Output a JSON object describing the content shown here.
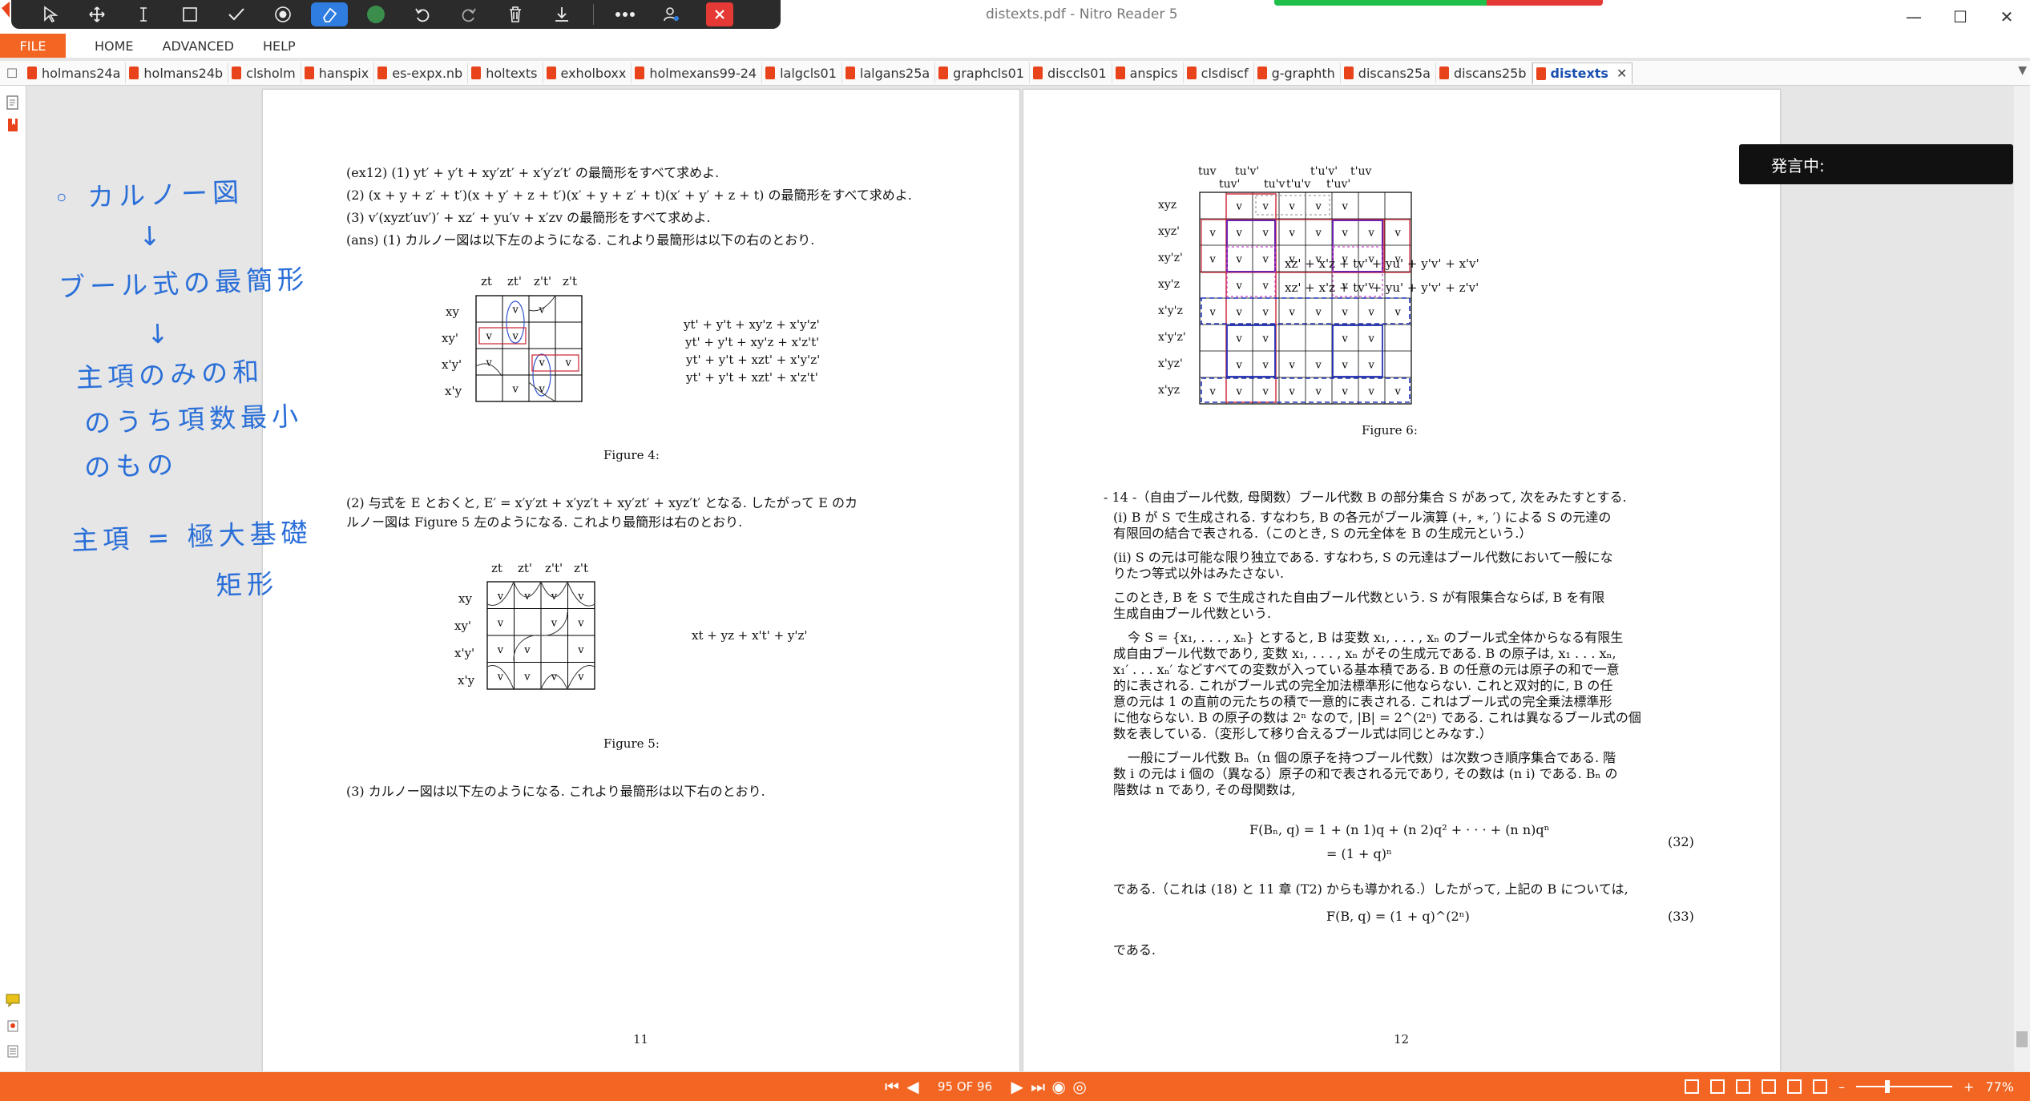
{
  "app": {
    "window_title": "distexts.pdf - Nitro Reader 5"
  },
  "window_buttons": [
    "—",
    "☐",
    "✕"
  ],
  "menu": {
    "file": "FILE",
    "items": [
      "HOME",
      "ADVANCED",
      "HELP"
    ]
  },
  "tabs": [
    "holmans24a",
    "holmans24b",
    "clsholm",
    "hanspix",
    "es-expx.nb",
    "holtexts",
    "exholboxx",
    "holmexans99-24",
    "lalgcls01",
    "lalgans25a",
    "graphcls01",
    "disccls01",
    "anspics",
    "clsdiscf",
    "g-graphth",
    "discans25a",
    "discans25b"
  ],
  "active_tab": "distexts",
  "active_tab_close": "✕",
  "page1": {
    "lines": [
      "(ex12) (1) yt′ + y′t + xy′zt′ + x′y′z′t′ の最簡形をすべて求めよ.",
      "(2) (x + y + z′ + t′)(x + y′ + z + t′)(x′ + y + z′ + t)(x′ + y′ + z + t) の最簡形をすべて求めよ.",
      "(3) v′(xyzt′uv′)′ + xz′ + yu′v + x′zv の最簡形をすべて求めよ.",
      "(ans) (1) カルノー図は以下左のようになる. これより最簡形は以下の右のとおり."
    ],
    "kmap4": {
      "cols": [
        "zt",
        "zt'",
        "z't'",
        "z't"
      ],
      "rows": [
        "xy",
        "xy'",
        "x'y'",
        "x'y"
      ],
      "cells": [
        [
          "",
          "v",
          "v",
          ""
        ],
        [
          "v",
          "v",
          "",
          ""
        ],
        [
          "v",
          "",
          "v",
          "v"
        ],
        [
          "",
          "v",
          "v",
          ""
        ]
      ],
      "results": [
        "yt' + y't + xy'z + x'y'z'",
        "yt' + y't + xy'z + x'z't'",
        "yt' + y't + xzt' + x'y'z'",
        "yt' + y't + xzt' + x'z't'"
      ],
      "caption": "Figure 4:"
    },
    "para2": [
      "(2) 与式を E とおくと, E′ = x′y′zt + x′yz′t + xy′zt′ + xyz′t′ となる. したがって E のカ",
      "ルノー図は Figure 5 左のようになる. これより最簡形は右のとおり."
    ],
    "kmap5": {
      "cols": [
        "zt",
        "zt'",
        "z't'",
        "z't"
      ],
      "rows": [
        "xy",
        "xy'",
        "x'y'",
        "x'y"
      ],
      "cells": [
        [
          "v",
          "v",
          "v",
          "v"
        ],
        [
          "v",
          "",
          "v",
          "v"
        ],
        [
          "v",
          "v",
          "",
          "v"
        ],
        [
          "v",
          "v",
          "v",
          "v"
        ]
      ],
      "result": "xt + yz + x't' + y'z'",
      "caption": "Figure 5:"
    },
    "para3": "(3) カルノー図は以下左のようになる. これより最簡形は以下右のとおり.",
    "page_number": "11"
  },
  "page2": {
    "kmap6": {
      "cols": [
        "tuv",
        "tuv'",
        "tu'v'",
        "tu'v",
        "t'u'v",
        "t'u'v'",
        "t'uv'",
        "t'uv"
      ],
      "rows": [
        "xyz",
        "xyz'",
        "xy'z'",
        "xy'z",
        "x'y'z",
        "x'y'z'",
        "x'yz'",
        "x'yz"
      ],
      "cells": [
        [
          "",
          "v",
          "v",
          "v",
          "v",
          "v",
          "",
          ""
        ],
        [
          "v",
          "v",
          "v",
          "v",
          "v",
          "v",
          "v",
          "v"
        ],
        [
          "v",
          "v",
          "v",
          "v",
          "v",
          "v",
          "v",
          "v"
        ],
        [
          "",
          "v",
          "v",
          "",
          "",
          "v",
          "v",
          ""
        ],
        [
          "v",
          "v",
          "v",
          "v",
          "v",
          "v",
          "v",
          "v"
        ],
        [
          "",
          "v",
          "v",
          "",
          "",
          "v",
          "v",
          ""
        ],
        [
          "",
          "v",
          "v",
          "v",
          "v",
          "v",
          "v",
          ""
        ],
        [
          "v",
          "v",
          "v",
          "v",
          "v",
          "v",
          "v",
          "v"
        ]
      ],
      "results": [
        "xz' + x'z + tv' + yu' + y'v' + x'v'",
        "xz' + x'z + tv' + yu' + y'v' + z'v'"
      ],
      "caption": "Figure 6:"
    },
    "paras": [
      "- 14 -（自由ブール代数, 母関数）ブール代数 B の部分集合 S があって, 次をみたすとする.",
      "(i) B が S で生成される. すなわち, B の各元がブール演算 (+, ∗, ′) による S の元達の",
      "有限回の結合で表される.（このとき, S の元全体を B の生成元という.）",
      "(ii) S の元は可能な限り独立である. すなわち, S の元達はブール代数において一般にな",
      "りたつ等式以外はみたさない.",
      "このとき, B を S で生成された自由ブール代数という. S が有限集合ならば, B を有限",
      "生成自由ブール代数という.",
      "今 S = {x₁, . . . , xₙ} とすると, B は変数 x₁, . . . , xₙ のブール式全体からなる有限生",
      "成自由ブール代数であり, 変数 x₁, . . . , xₙ がその生成元である. B の原子は, x₁ . . . xₙ,",
      "x₁′ . . . xₙ′ などすべての変数が入っている基本積である. B の任意の元は原子の和で一意",
      "的に表される. これがブール式の完全加法標準形に他ならない. これと双対的に, B の任",
      "意の元は 1 の直前の元たちの積で一意的に表される. これはブール式の完全乗法標準形",
      "に他ならない. B の原子の数は 2ⁿ なので, |B| = 2^(2ⁿ) である. これは異なるブール式の個",
      "数を表している.（変形して移り合えるブール式は同じとみなす.）",
      "一般にブール代数 Bₙ（n 個の原子を持つブール代数）は次数つき順序集合である. 階",
      "数 i の元は i 個の（異なる）原子の和で表される元であり, その数は (n i) である. Bₙ の",
      "階数は n であり, その母関数は,"
    ],
    "eq32_line1": "F(Bₙ, q)  = 1 + (n 1)q + (n 2)q² + · · · + (n n)qⁿ",
    "eq32_line2": "= (1 + q)ⁿ",
    "eq32_num": "(32)",
    "after32": "である.（これは (18) と 11 章 (T2) からも導かれる.）したがって, 上記の B については,",
    "eq33": "F(B, q) = (1 + q)^(2ⁿ)",
    "eq33_num": "(33)",
    "end": "である.",
    "page_number": "12"
  },
  "handwritten_notes": [
    "◦ カルノー図",
    "↓",
    "ブール式の最簡形",
    "↓",
    "主項のみの和",
    "のうち項数最小",
    "のもの",
    "主項 = 極大基礎",
    "矩形"
  ],
  "popup": {
    "label": "発言中:"
  },
  "status": {
    "page_indicator": "95 OF 96",
    "zoom": "77%"
  },
  "colors": {
    "accent": "#f26522",
    "highlight_blue": "#2f7de1",
    "note_blue": "#2a6fd8"
  }
}
